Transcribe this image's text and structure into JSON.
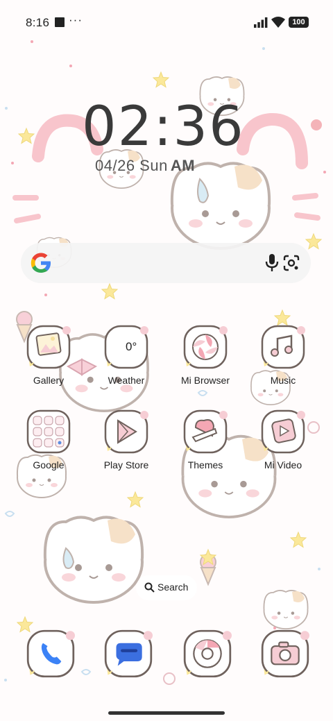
{
  "status_bar": {
    "time": "8:16",
    "more": "···",
    "battery": "100"
  },
  "clock": {
    "time": "02:36",
    "date": "04/26 Sun",
    "ampm": "AM"
  },
  "search_widget": {
    "logo": "google-g-icon"
  },
  "apps": [
    {
      "label": "Gallery"
    },
    {
      "label": "Weather",
      "temp": "0°"
    },
    {
      "label": "Mi Browser"
    },
    {
      "label": "Music"
    },
    {
      "label": "Google"
    },
    {
      "label": "Play Store"
    },
    {
      "label": "Themes"
    },
    {
      "label": "Mi Video"
    }
  ],
  "search_pill": {
    "label": "Search"
  },
  "dock": [
    "phone-icon",
    "messages-icon",
    "chrome-icon",
    "camera-icon"
  ],
  "colors": {
    "accent_pink": "#f4a7b4",
    "cream": "#f6e6c8",
    "outline": "#8a7d78",
    "yellow_star": "#fbe89a"
  }
}
